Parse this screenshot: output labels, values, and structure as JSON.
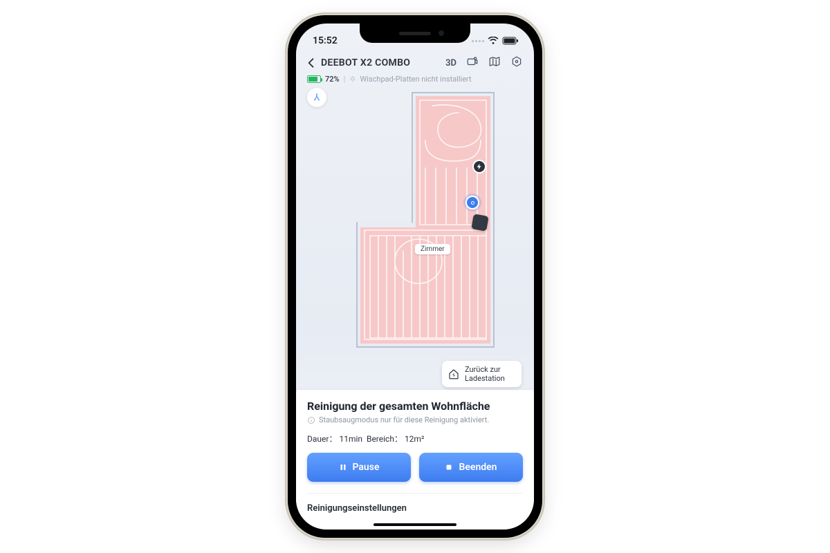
{
  "statusbar": {
    "time": "15:52"
  },
  "header": {
    "device_name": "DEEBOT X2 COMBO",
    "view3d_label": "3D"
  },
  "battery": {
    "percent_label": "72%"
  },
  "accessory_status": "Wischpad-Platten nicht installiert",
  "map": {
    "room_label": "Zimmer",
    "return_to_dock": "Zurück zur Ladestation"
  },
  "panel": {
    "title": "Reinigung der gesamten Wohnfläche",
    "subtitle": "Staubsaugmodus nur für diese Reinigung aktiviert.",
    "duration_label": "Dauer",
    "duration_value": "11min",
    "area_label": "Bereich",
    "area_value": "12m²",
    "pause_label": "Pause",
    "end_label": "Beenden",
    "settings_label": "Reinigungseinstellungen"
  }
}
